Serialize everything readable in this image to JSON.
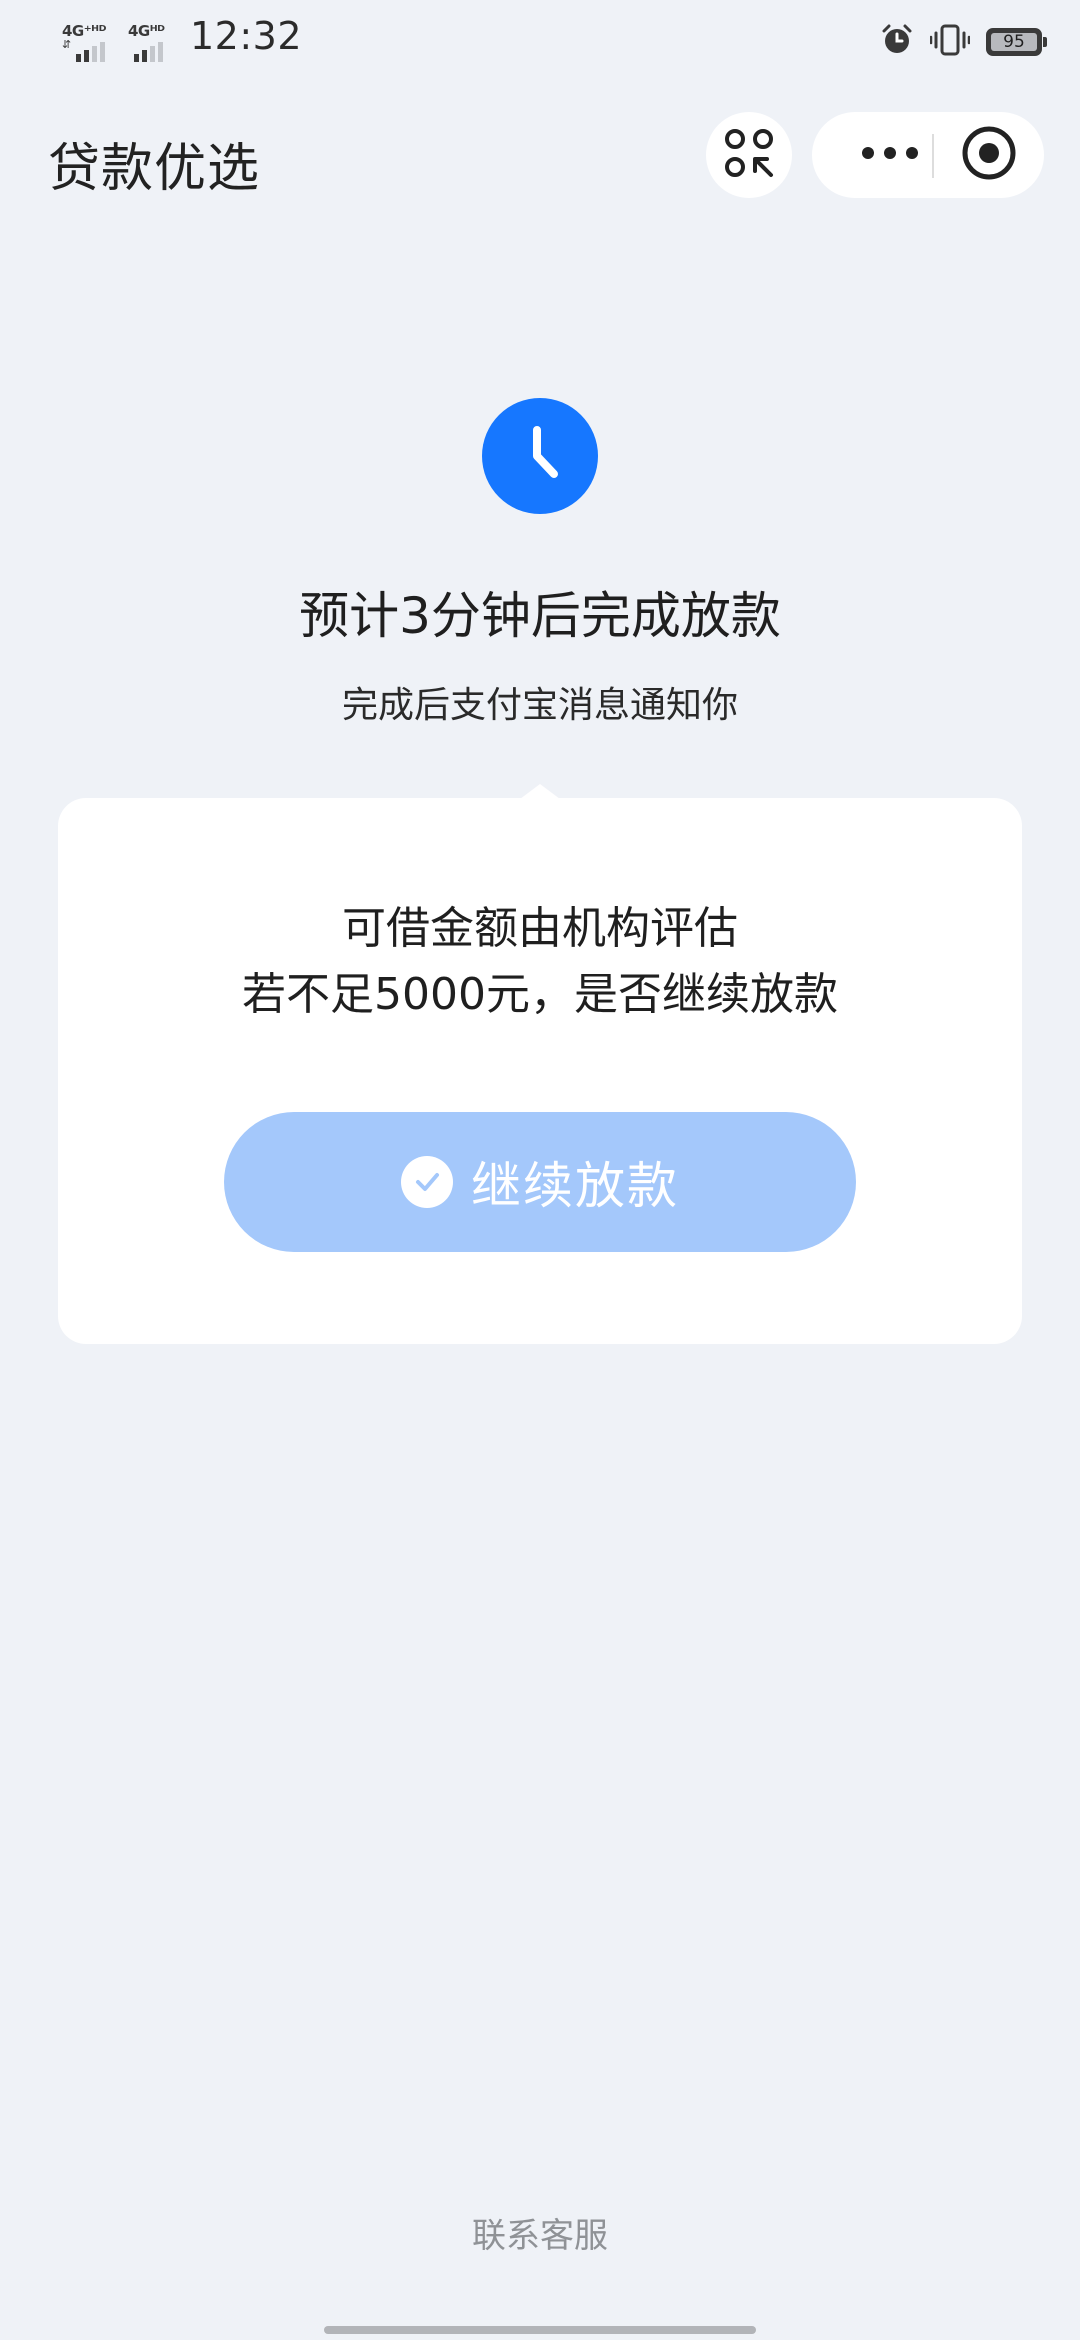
{
  "status_bar": {
    "network_1": "4G⁺ᴴᴰ",
    "network_2": "4Gᴴᴰ",
    "time": "12:32",
    "battery": "95",
    "alarm_icon": "alarm-clock-icon",
    "vibrate_icon": "vibrate-icon"
  },
  "header": {
    "title": "贷款优选",
    "mini_program_icon": "mini-program-switch-icon",
    "more_icon": "more-dots-icon",
    "close_icon": "close-target-icon"
  },
  "status": {
    "icon": "clock-icon",
    "icon_color": "#1677ff",
    "headline": "预计3分钟后完成放款",
    "subline": "完成后支付宝消息通知你"
  },
  "card": {
    "line1": "可借金额由机构评估",
    "line2": "若不足5000元，是否继续放款",
    "button_label": "继续放款",
    "button_icon": "check-circle-icon",
    "button_color": "#a4c8fb"
  },
  "footer": {
    "contact_label": "联系客服"
  }
}
